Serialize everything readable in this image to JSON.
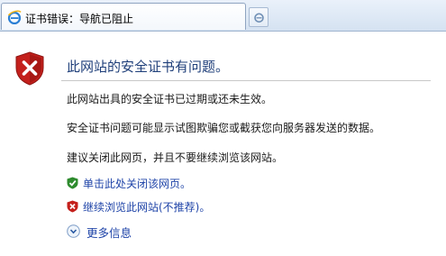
{
  "tab": {
    "title": "证书错误：导航已阻止",
    "icon": "ie-logo-icon"
  },
  "new_tab_icon": "ie-logo-icon",
  "page": {
    "heading": "此网站的安全证书有问题。",
    "shield_icon": "red-x-shield-icon",
    "para1": "此网站出具的安全证书已过期或还未生效。",
    "para2": "安全证书问题可能显示试图欺骗您或截获您向服务器发送的数据。",
    "para3": "建议关闭此网页，并且不要继续浏览该网站。",
    "link_close": "单击此处关闭该网页。",
    "link_close_icon": "green-check-shield-icon",
    "link_continue": "继续浏览此网站(不推荐)。",
    "link_continue_icon": "red-x-shield-icon",
    "more_info": "更多信息",
    "more_info_icon": "chevron-down-circle-icon"
  },
  "colors": {
    "heading": "#1f3f7a",
    "link": "#1f44a8",
    "danger": "#c4201c",
    "safe": "#2e8b2e"
  }
}
